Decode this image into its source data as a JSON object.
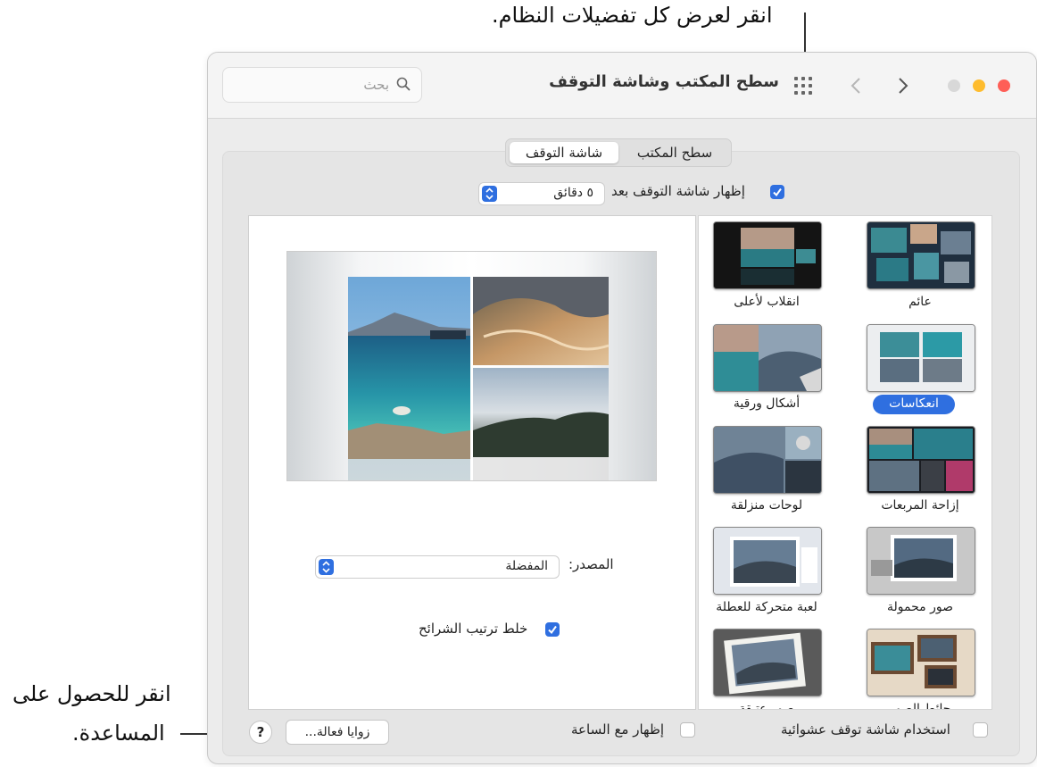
{
  "callouts": {
    "top": "انقر لعرض كل تفضيلات النظام.",
    "help_line1": "انقر للحصول على",
    "help_line2": "المساعدة."
  },
  "window": {
    "title": "سطح المكتب وشاشة التوقف",
    "search_placeholder": "بحث"
  },
  "tabs": [
    "سطح المكتب",
    "شاشة التوقف"
  ],
  "active_tab": "شاشة التوقف",
  "show_after": {
    "label": "إظهار شاشة التوقف بعد",
    "checked": true,
    "value": "٥ دقائق"
  },
  "source": {
    "label": "المصدر:",
    "value": "المفضلة"
  },
  "shuffle": {
    "label": "خلط ترتيب الشرائح",
    "checked": true
  },
  "screensavers": [
    {
      "label": "عائم",
      "selected": false
    },
    {
      "label": "انقلاب لأعلى",
      "selected": false
    },
    {
      "label": "انعكاسات",
      "selected": true
    },
    {
      "label": "أشكال ورقية",
      "selected": false
    },
    {
      "label": "إزاحة المربعات",
      "selected": false
    },
    {
      "label": "لوحات منزلقة",
      "selected": false
    },
    {
      "label": "صور محمولة",
      "selected": false
    },
    {
      "label": "لعبة متحركة للعطلة",
      "selected": false
    },
    {
      "label": "حائط الصور",
      "selected": false
    },
    {
      "label": "صور عتيقة",
      "selected": false
    }
  ],
  "footer": {
    "random_label": "استخدام شاشة توقف عشوائية",
    "random_checked": false,
    "clock_label": "إظهار مع الساعة",
    "clock_checked": false,
    "hot_corners": "زوايا فعالة...",
    "help": "?"
  },
  "colors": {
    "accent": "#2f6fe0",
    "close": "#fe5f57",
    "minimize": "#febc2e",
    "zoom": "#d8d8d8"
  }
}
